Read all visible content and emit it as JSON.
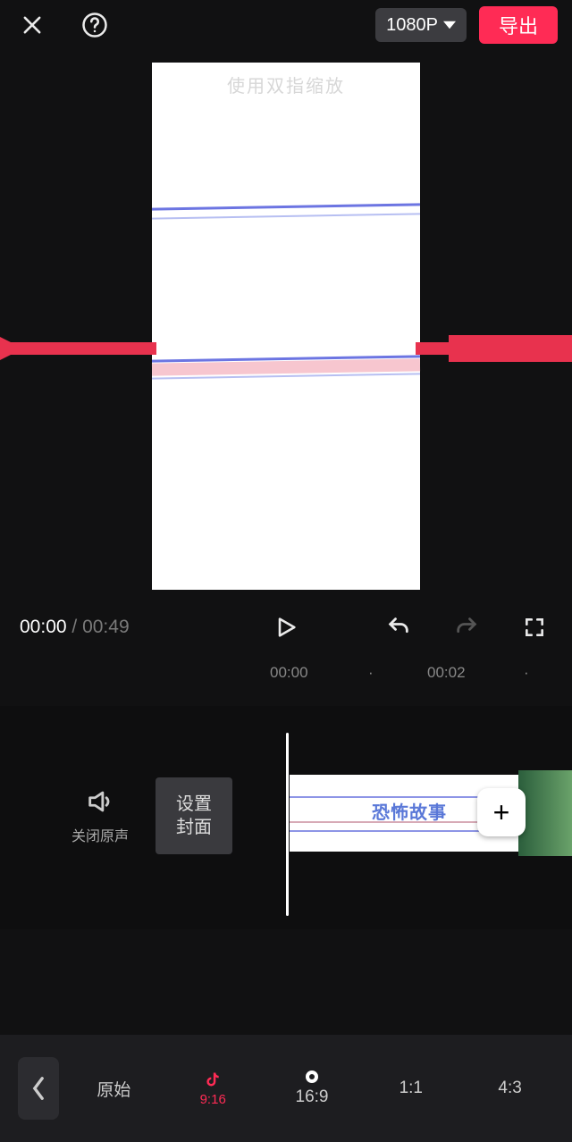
{
  "topbar": {
    "resolution_label": "1080P",
    "export_label": "导出"
  },
  "preview": {
    "hint": "使用双指缩放"
  },
  "transport": {
    "current": "00:00",
    "sep": " / ",
    "duration": "00:49"
  },
  "ruler": {
    "t0": "00:00",
    "t1": "00:02"
  },
  "timeline": {
    "mute_label": "关闭原声",
    "cover_label": "设置\n封面",
    "clip_caption": "恐怖故事",
    "add_label": "+"
  },
  "ratio": {
    "original": "原始",
    "r916": "9:16",
    "r169": "16:9",
    "r11": "1:1",
    "r43": "4:3"
  }
}
